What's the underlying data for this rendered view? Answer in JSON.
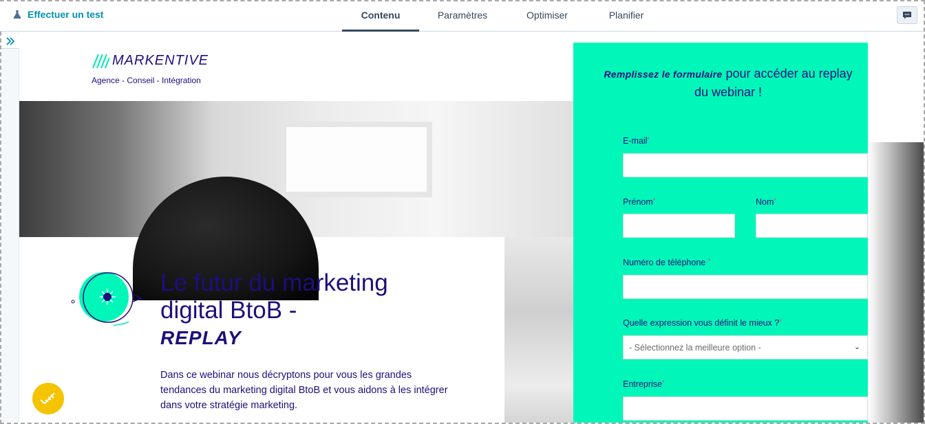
{
  "editor": {
    "test_link": "Effectuer un test",
    "tabs": [
      {
        "label": "Contenu",
        "active": true
      },
      {
        "label": "Paramètres",
        "active": false
      },
      {
        "label": "Optimiser",
        "active": false
      },
      {
        "label": "Planifier",
        "active": false
      }
    ],
    "icons": [
      "flask-icon",
      "chat-icon",
      "expand-icon"
    ]
  },
  "page": {
    "logo": {
      "word": "MARKENTIVE",
      "tagline": "Agence - Conseil - Intégration"
    },
    "headline": {
      "main": "Le futur du marketing digital BtoB -",
      "accent": "REPLAY"
    },
    "description": "Dans ce webinar nous décryptons pour vous les grandes tendances du marketing digital BtoB et vous aidons à les intégrer dans votre stratégie marketing.",
    "colors": {
      "brand_dark": "#1d0f7c",
      "form_bg": "#00f7b9",
      "help_fab": "#f5c400",
      "required": "#ff3b6b"
    }
  },
  "form": {
    "title_emphasis": "Remplissez le formulaire",
    "title_rest": "pour accéder au replay du webinar !",
    "fields": {
      "email": {
        "label": "E-mail",
        "required": true,
        "value": ""
      },
      "firstname": {
        "label": "Prénom",
        "required": true,
        "value": ""
      },
      "lastname": {
        "label": "Nom",
        "required": true,
        "value": ""
      },
      "phone": {
        "label": "Numéro de téléphone",
        "required": true,
        "value": ""
      },
      "expression": {
        "label": "Quelle expression vous définit le mieux ?",
        "required": true,
        "selected": "- Sélectionnez la meilleure option -"
      },
      "company": {
        "label": "Entreprise",
        "required": true,
        "value": ""
      }
    },
    "required_mark": "*"
  }
}
